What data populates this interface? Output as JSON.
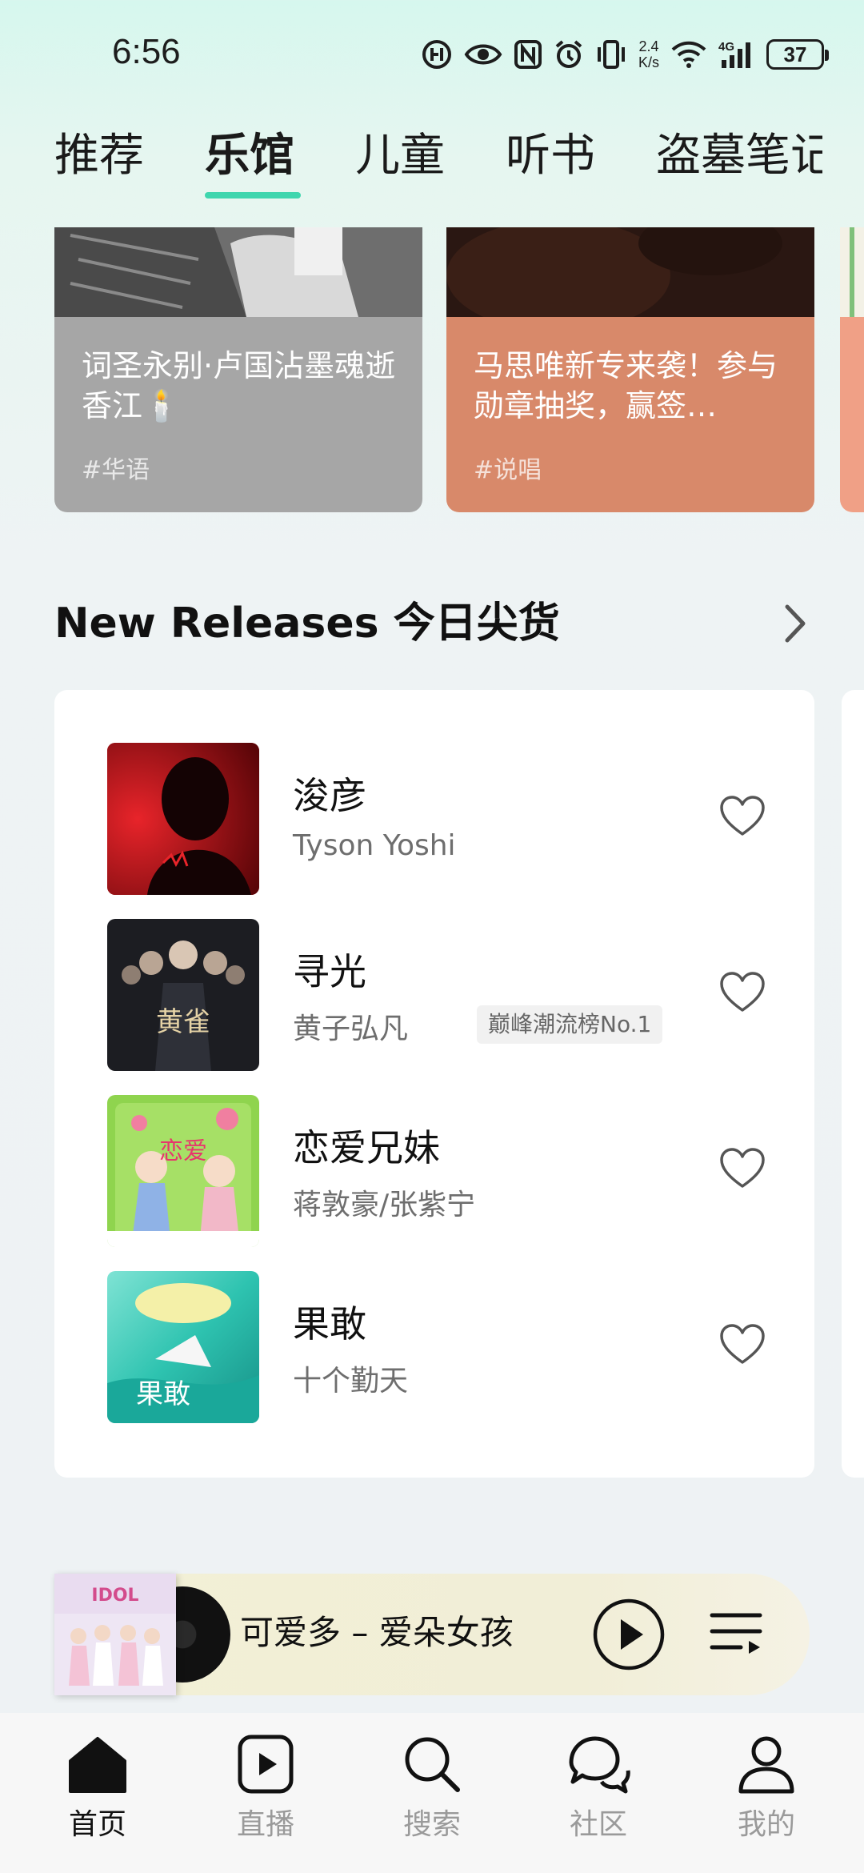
{
  "status_bar": {
    "time": "6:56",
    "net_speed_value": "2.4",
    "net_speed_unit": "K/s",
    "network": "4G",
    "battery": "37",
    "icons": [
      "hd-voice-icon",
      "eye-icon",
      "nfc-icon",
      "alarm-icon",
      "vibrate-icon",
      "wifi-icon",
      "signal-icon",
      "battery-icon"
    ]
  },
  "top_tabs": [
    {
      "label": "推荐",
      "active": false
    },
    {
      "label": "乐馆",
      "active": true
    },
    {
      "label": "儿童",
      "active": false
    },
    {
      "label": "听书",
      "active": false
    },
    {
      "label": "盗墓笔记",
      "active": false
    }
  ],
  "banners": [
    {
      "title": "词圣永别·卢国沾墨魂逝香江🕯️",
      "tag": "#华语",
      "color": "#a6a6a6"
    },
    {
      "title": "马思唯新专来袭！参与勋章抽奖，赢签…",
      "tag": "#说唱",
      "color": "#d8896a"
    }
  ],
  "new_releases": {
    "title": "New Releases 今日尖货",
    "songs": [
      {
        "title": "浚彦",
        "artist": "Tyson Yoshi",
        "badge": ""
      },
      {
        "title": "寻光",
        "artist": "黄子弘凡",
        "badge": "巅峰潮流榜No.1"
      },
      {
        "title": "恋爱兄妹",
        "artist": "蒋敦豪/张紫宁",
        "badge": ""
      },
      {
        "title": "果敢",
        "artist": "十个勤天",
        "badge": ""
      }
    ]
  },
  "mini_player": {
    "now_playing": "可爱多 – 爱朵女孩"
  },
  "bottom_nav": [
    {
      "label": "首页",
      "icon": "home-icon",
      "active": true
    },
    {
      "label": "直播",
      "icon": "live-play-icon",
      "active": false
    },
    {
      "label": "搜索",
      "icon": "search-icon",
      "active": false
    },
    {
      "label": "社区",
      "icon": "community-chat-icon",
      "active": false
    },
    {
      "label": "我的",
      "icon": "profile-icon",
      "active": false
    }
  ],
  "colors": {
    "accent": "#3fd6ae",
    "text_primary": "#111111",
    "text_secondary": "#6e6e6e"
  }
}
